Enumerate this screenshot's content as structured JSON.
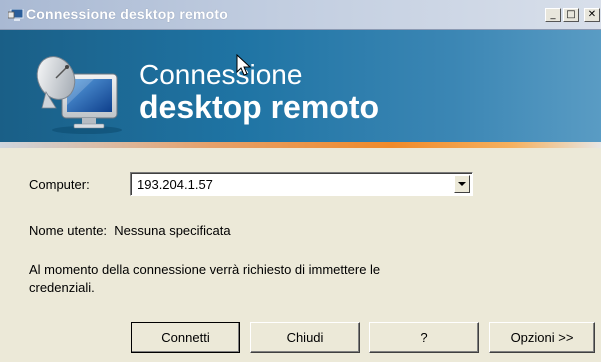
{
  "window": {
    "title": "Connessione desktop remoto"
  },
  "banner": {
    "line1": "Connessione",
    "line2": "desktop remoto"
  },
  "form": {
    "computer_label": "Computer:",
    "computer_value": "193.204.1.57",
    "username_text": "Nome utente:  Nessuna specificata",
    "info_line1": "Al momento della connessione verrà richiesto di immettere le",
    "info_line2": "credenziali."
  },
  "buttons": {
    "connect": "Connetti",
    "close": "Chiudi",
    "help": "?",
    "options": "Opzioni >>"
  },
  "titlebar_buttons": {
    "minimize": "_",
    "maximize": "□",
    "close": "✕"
  },
  "colors": {
    "banner": "#1f74a4",
    "accent_stripe": "#f08a2a",
    "background": "#ece9d8"
  }
}
